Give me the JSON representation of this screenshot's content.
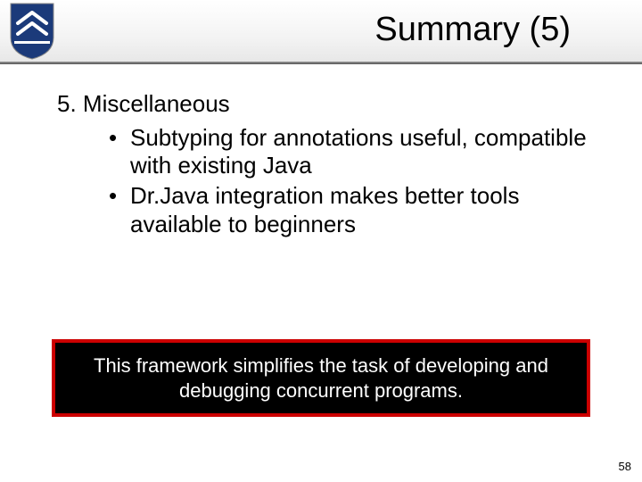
{
  "header": {
    "title": "Summary (5)"
  },
  "list": {
    "number": "5.",
    "heading": "Miscellaneous",
    "bullets": [
      "Subtyping for annotations useful, compatible with existing Java",
      "Dr.Java integration makes better tools available to beginners"
    ]
  },
  "callout": "This framework simplifies the task of developing and debugging concurrent programs.",
  "page_number": "58",
  "colors": {
    "callout_border": "#cc0000",
    "callout_bg": "#000000"
  }
}
